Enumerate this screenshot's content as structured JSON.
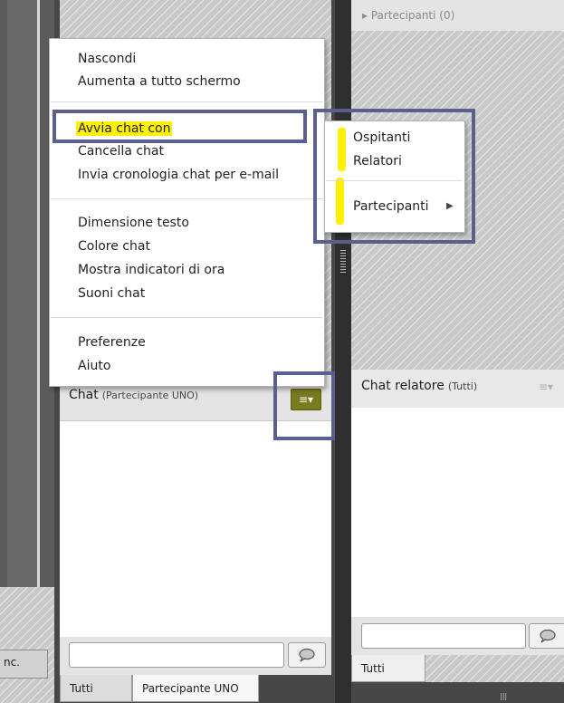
{
  "left_panel": {
    "inc_label": "nc."
  },
  "participants_pod": {
    "title": "Partecipanti (0)"
  },
  "chat_pod": {
    "title": "Chat",
    "subtitle": "(Partecipante UNO)",
    "options_icon": "menu-lines-icon",
    "tabs": [
      "Tutti",
      "Partecipante UNO"
    ]
  },
  "presenter_chat_pod": {
    "title": "Chat relatore",
    "subtitle": "(Tutti)",
    "options_icon": "menu-lines-icon",
    "tabs": [
      "Tutti"
    ]
  },
  "context_menu": {
    "group1": [
      "Nascondi",
      "Aumenta a tutto schermo"
    ],
    "group2": [
      "Avvia chat con",
      "Cancella chat",
      "Invia cronologia chat per e-mail"
    ],
    "group3": [
      "Dimensione testo",
      "Colore chat",
      "Mostra indicatori di ora",
      "Suoni chat"
    ],
    "group4": [
      "Preferenze",
      "Aiuto"
    ]
  },
  "submenu": {
    "items": [
      "Ospitanti",
      "Relatori"
    ],
    "participants_item": "Partecipanti"
  },
  "colors": {
    "highlight": "#fff100",
    "annotation_box": "#5a5f8e",
    "options_button": "#7a7a1e"
  }
}
